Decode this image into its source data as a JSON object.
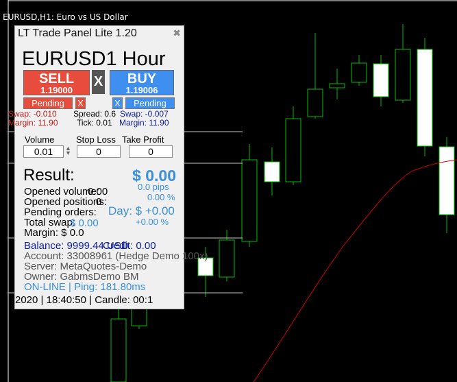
{
  "chart": {
    "title": "EURUSD,H1:  Euro vs US Dollar",
    "colors": {
      "background": "#000000",
      "grid": "#ffffff",
      "bull": "#00c000",
      "candle_body": "#ffffff",
      "moving_average": "#cc0000"
    }
  },
  "panel": {
    "title": "LT Trade Panel Lite 1.20",
    "close_icon": "close-icon",
    "symbol_text": "EURUSD1 Hour",
    "sell": {
      "label": "SELL",
      "price": "1.19000"
    },
    "buy": {
      "label": "BUY",
      "price": "1.19006"
    },
    "close_all": "X",
    "pending_sell": "Pending",
    "pending_sell_x": "X",
    "pending_buy_x": "X",
    "pending_buy": "Pending",
    "swap_sell": "Swap: -0.010",
    "spread": "Spread: 0.6",
    "swap_buy": "Swap: -0.007",
    "margin_sell": "Margin: 11.90",
    "tick": "Tick: 0.01",
    "margin_buy": "Margin: 11.90",
    "volume_label": "Volume",
    "volume_value": "0.01",
    "stoploss_label": "Stop Loss",
    "stoploss_value": "0",
    "takeprofit_label": "Take Profit",
    "takeprofit_value": "0",
    "result_label": "Result:",
    "result_value": "$ 0.00",
    "result_pips": "0.0 pips",
    "result_pct": "0.00 %",
    "opened_volume": "Opened volume:",
    "opened_volume_val": "0.00",
    "opened_positions": "Opened positions:",
    "opened_positions_val": "0",
    "pending_orders": "Pending orders:",
    "day_label": "Day: $ +0.00",
    "total_swap": "Total swap:",
    "total_swap_val": "$ 0.00",
    "day_pct": "+0.00 %",
    "margin_total": "Margin: $ 0.0",
    "balance": "Balance: 9999.44 USD",
    "credit": "Credit: 0.00",
    "account": "Account: 33008961 (Hedge Demo 100x)",
    "server": "Server: MetaQuotes-Demo",
    "owner": "Owner: GabmsDemo BM",
    "online": "ON-LINE | Ping: 181.80ms",
    "status_line": "2020 | 18:40:50 | Candle: 00:1"
  }
}
